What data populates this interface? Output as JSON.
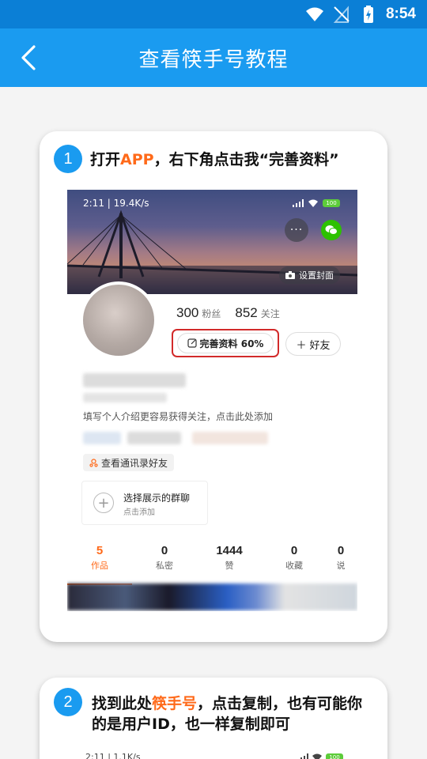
{
  "status_bar": {
    "time": "8:54"
  },
  "app_bar": {
    "title": "查看筷手号教程"
  },
  "step1": {
    "number": "1",
    "title_before": "打开",
    "title_highlight": "APP",
    "title_after": "，右下角点击我“完善资料”",
    "screenshot": {
      "status_left": "2:11 | 19.4K/s",
      "battery": "100",
      "more_label": "···",
      "cover_label": "设置封面",
      "fans_count": "300",
      "fans_label": "粉丝",
      "following_count": "852",
      "following_label": "关注",
      "complete_label": "完善资料 60%",
      "friend_label": "好友",
      "intro_text": "填写个人介绍更容易获得关注，点击此处添加",
      "contacts_label": "查看通讯录好友",
      "group_title": "选择展示的群聊",
      "group_subtitle": "点击添加",
      "tabs": [
        {
          "count": "5",
          "label": "作品"
        },
        {
          "count": "0",
          "label": "私密"
        },
        {
          "count": "1444",
          "label": "赞"
        },
        {
          "count": "0",
          "label": "收藏"
        },
        {
          "count": "0",
          "label": "说"
        }
      ]
    }
  },
  "step2": {
    "number": "2",
    "title_before": "找到此处",
    "title_highlight": "筷手号",
    "title_after": "，点击复制，也有可能你的是用户ID，也一样复制即可",
    "screenshot": {
      "status_left": "2:11 | 1.1K/s",
      "battery": "100"
    }
  },
  "colors": {
    "status_bar": "#0b7fd6",
    "app_bar": "#1a9bf0",
    "highlight": "#ff6a1a",
    "step_badge": "#1a9bf0",
    "red_frame": "#d22a2a",
    "wechat_green": "#2dc100"
  }
}
